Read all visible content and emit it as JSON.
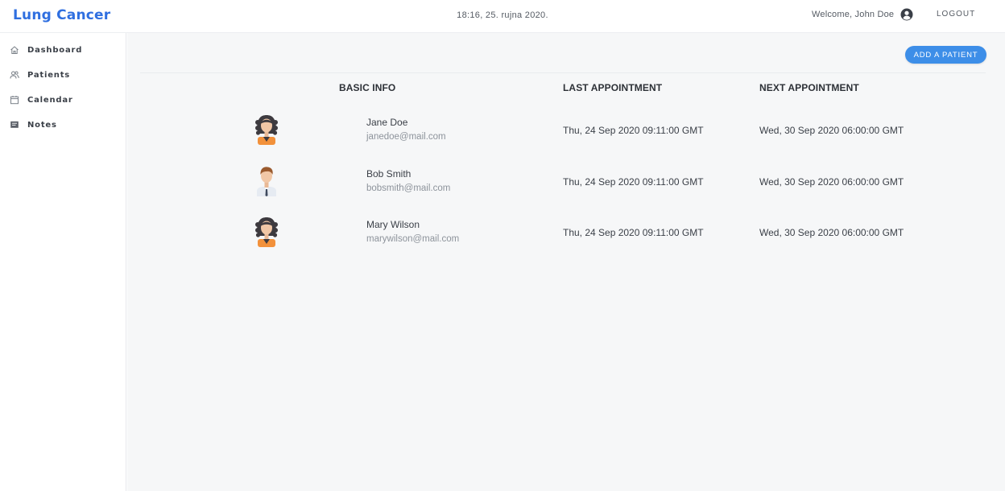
{
  "header": {
    "brand": "Lung Cancer",
    "datetime": "18:16, 25. rujna 2020.",
    "welcome": "Welcome, John Doe",
    "logout": "LOGOUT"
  },
  "sidebar": {
    "items": [
      {
        "label": "Dashboard",
        "icon": "home-icon"
      },
      {
        "label": "Patients",
        "icon": "users-icon"
      },
      {
        "label": "Calendar",
        "icon": "calendar-icon"
      },
      {
        "label": "Notes",
        "icon": "notes-icon"
      }
    ]
  },
  "main": {
    "add_button": "ADD A PATIENT",
    "columns": [
      "BASIC INFO",
      "LAST APPOINTMENT",
      "NEXT APPOINTMENT"
    ],
    "patients": [
      {
        "name": "Jane Doe",
        "email": "janedoe@mail.com",
        "avatar": "female-avatar-icon",
        "last": "Thu, 24 Sep 2020 09:11:00 GMT",
        "next": "Wed, 30 Sep 2020 06:00:00 GMT"
      },
      {
        "name": "Bob Smith",
        "email": "bobsmith@mail.com",
        "avatar": "male-avatar-icon",
        "last": "Thu, 24 Sep 2020 09:11:00 GMT",
        "next": "Wed, 30 Sep 2020 06:00:00 GMT"
      },
      {
        "name": "Mary Wilson",
        "email": "marywilson@mail.com",
        "avatar": "female-avatar-icon",
        "last": "Thu, 24 Sep 2020 09:11:00 GMT",
        "next": "Wed, 30 Sep 2020 06:00:00 GMT"
      }
    ]
  },
  "colors": {
    "brand": "#2f6fe0",
    "button": "#3d8ee8",
    "background": "#f6f7f8"
  }
}
